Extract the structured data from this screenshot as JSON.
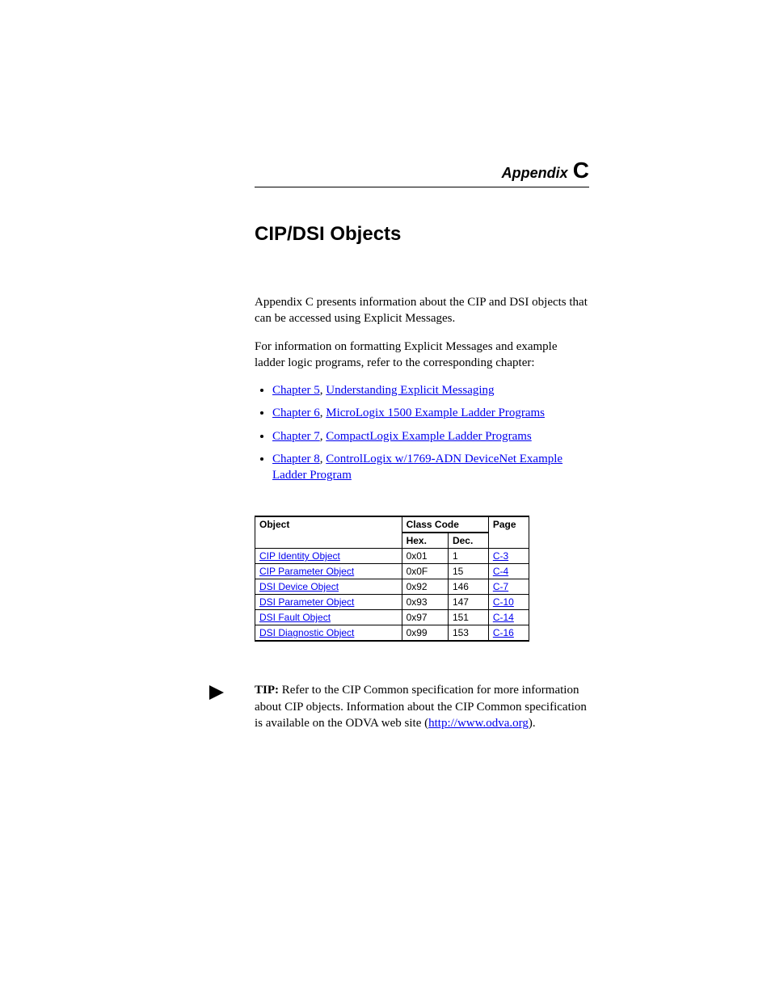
{
  "header": {
    "appendix_label": "Appendix",
    "appendix_letter": "C"
  },
  "title": "CIP/DSI Objects",
  "intro": {
    "p1": "Appendix C presents information about the CIP and DSI objects that can be accessed using Explicit Messages.",
    "p2": "For information on formatting Explicit Messages and example ladder logic programs, refer to the corresponding chapter:"
  },
  "bullets": [
    {
      "chapter": "Chapter 5",
      "title": "Understanding Explicit Messaging"
    },
    {
      "chapter": "Chapter 6",
      "title": "MicroLogix 1500 Example Ladder Programs"
    },
    {
      "chapter": "Chapter 7",
      "title": "CompactLogix Example Ladder Programs"
    },
    {
      "chapter": "Chapter 8",
      "title": "ControlLogix w/1769-ADN DeviceNet Example Ladder Program"
    }
  ],
  "table": {
    "headers": {
      "object": "Object",
      "class_code": "Class Code",
      "hex": "Hex.",
      "dec": "Dec.",
      "page": "Page"
    },
    "rows": [
      {
        "name": "CIP Identity Object",
        "hex": "0x01",
        "dec": "1",
        "page": "C-3"
      },
      {
        "name": "CIP Parameter Object",
        "hex": "0x0F",
        "dec": "15",
        "page": "C-4"
      },
      {
        "name": "DSI Device Object",
        "hex": "0x92",
        "dec": "146",
        "page": "C-7"
      },
      {
        "name": "DSI Parameter Object",
        "hex": "0x93",
        "dec": "147",
        "page": "C-10"
      },
      {
        "name": "DSI Fault Object",
        "hex": "0x97",
        "dec": "151",
        "page": "C-14"
      },
      {
        "name": "DSI Diagnostic Object",
        "hex": "0x99",
        "dec": "153",
        "page": "C-16"
      }
    ]
  },
  "tip": {
    "label": "TIP:",
    "text_before": "Refer to the CIP Common specification for more information about CIP objects. Information about the CIP Common specification is available on the ODVA web site (",
    "url": "http://www.odva.org",
    "text_after": ")."
  }
}
